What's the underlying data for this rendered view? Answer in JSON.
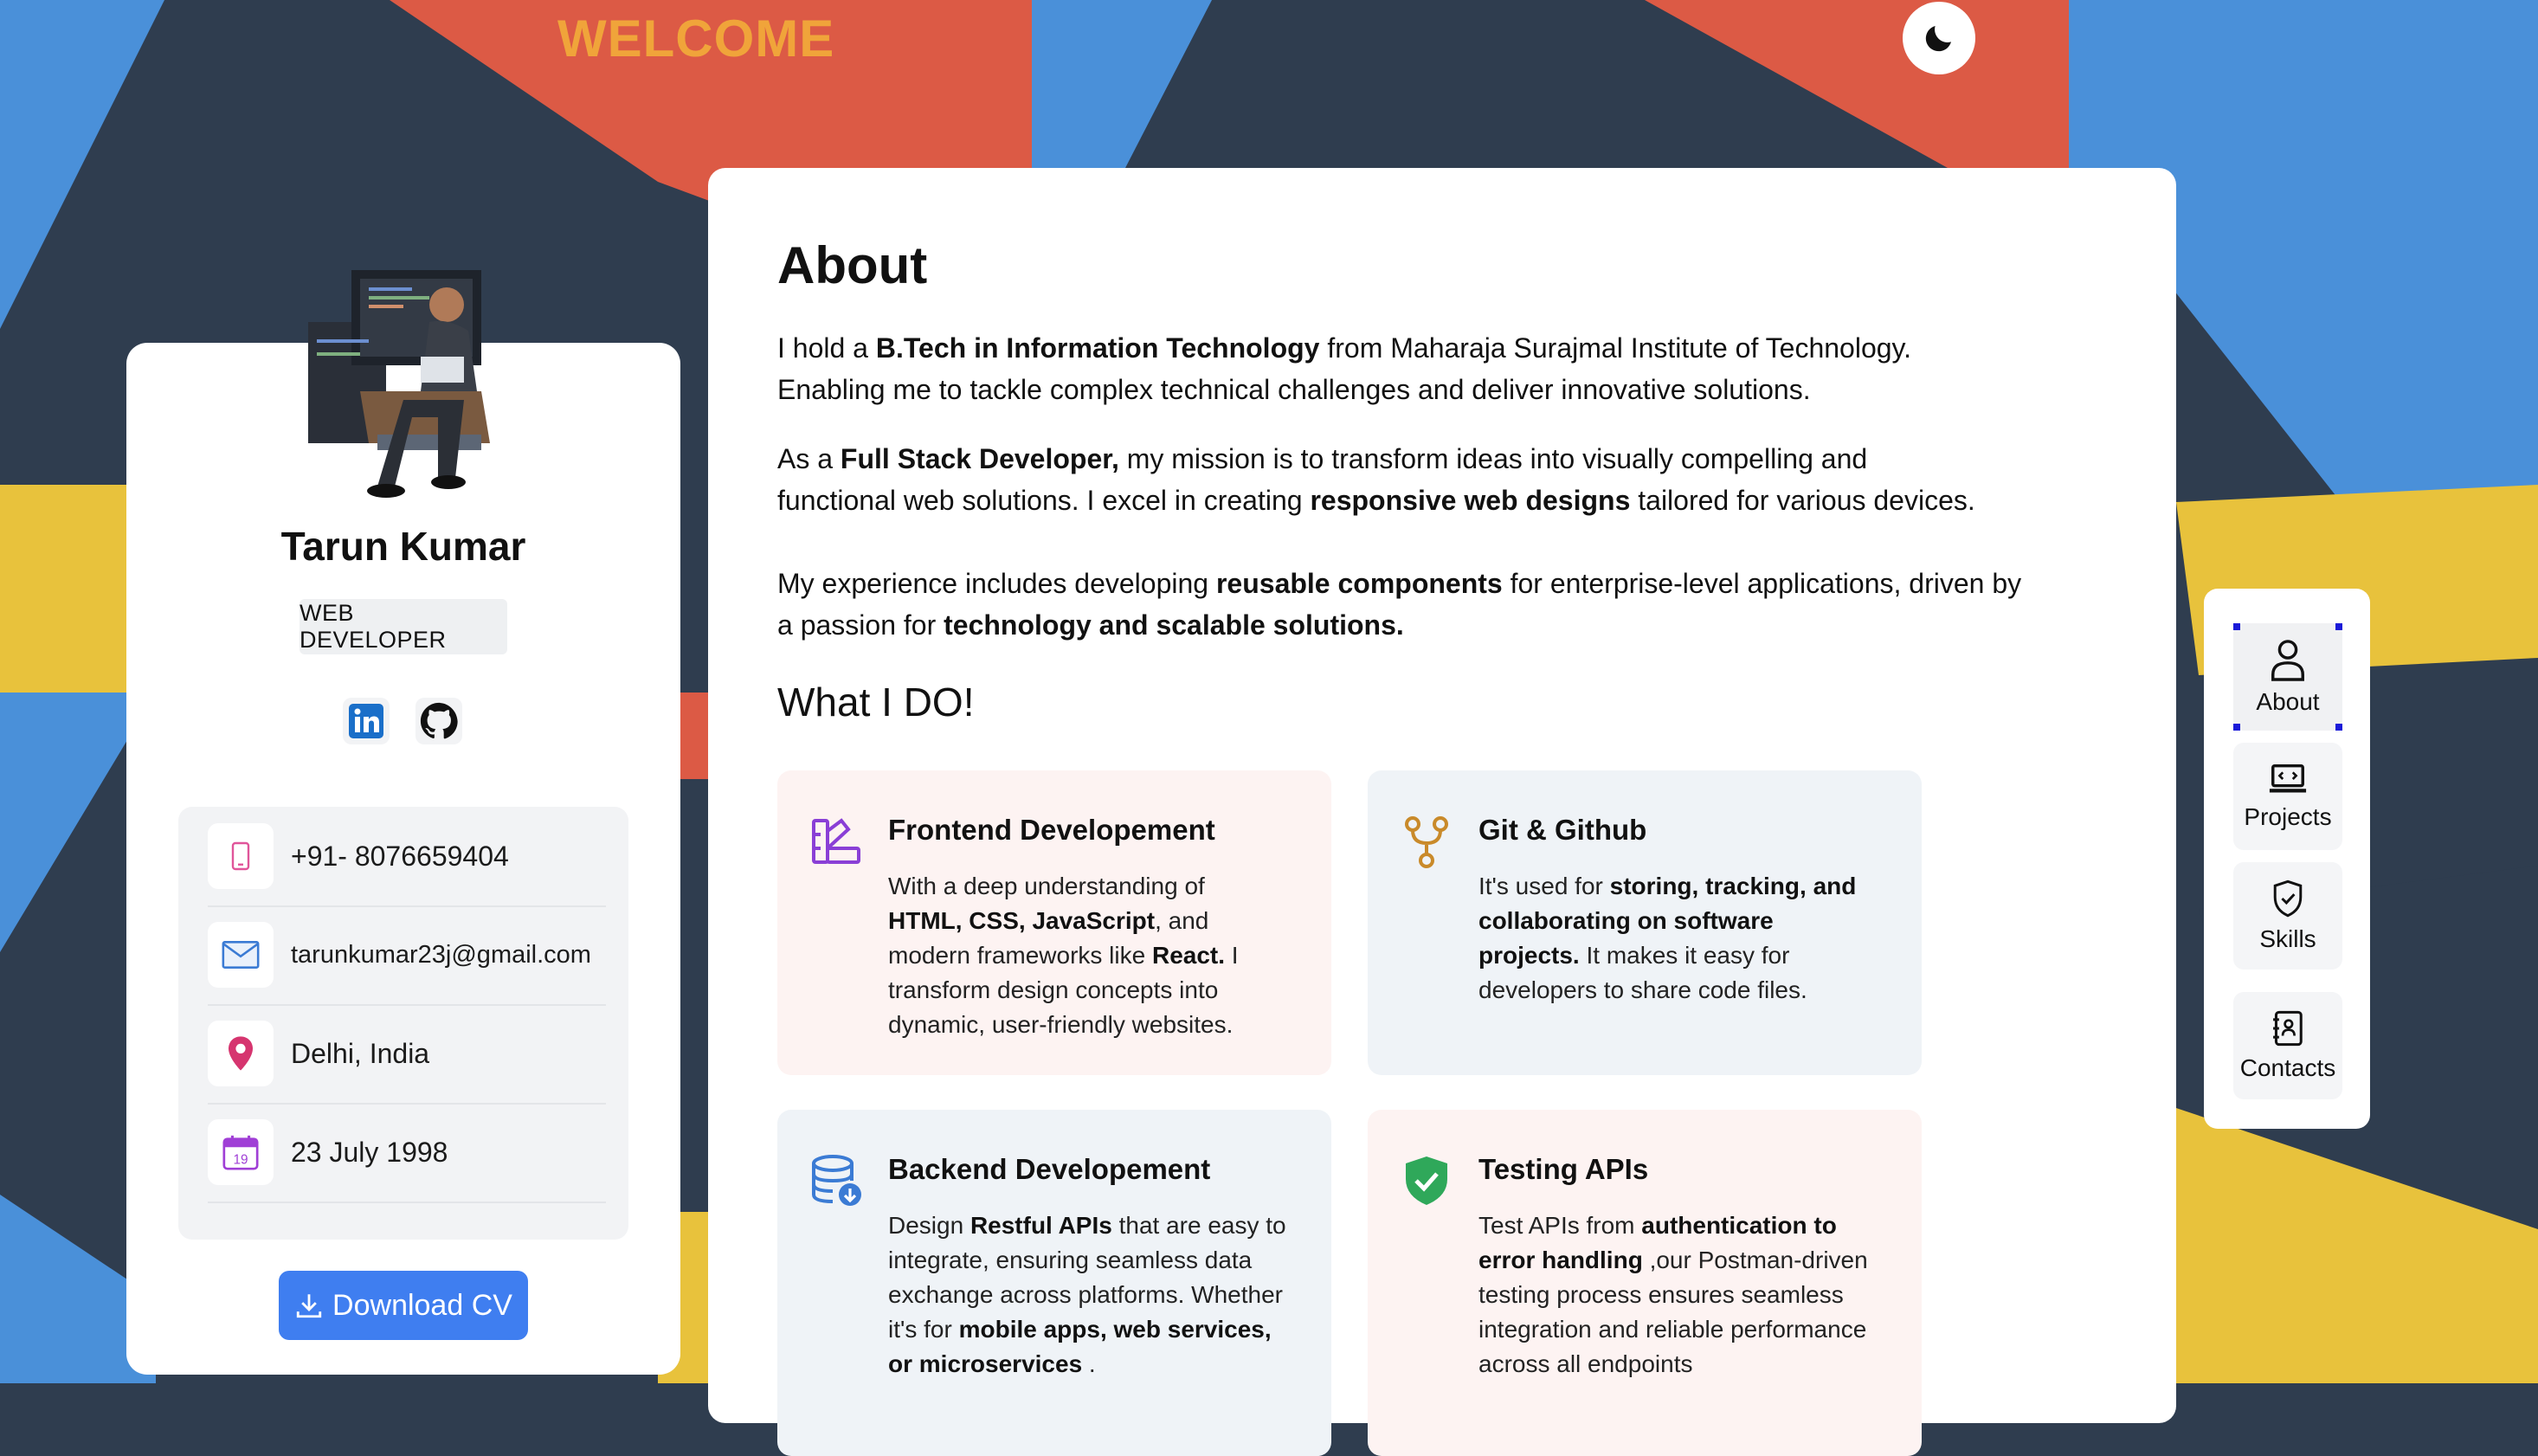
{
  "header": {
    "welcome": "WELCOME",
    "theme_toggle_icon": "moon-icon"
  },
  "profile": {
    "name": "Tarun Kumar",
    "role": "WEB DEVELOPER",
    "avatar_icon": "developer-illustration",
    "socials": [
      {
        "icon": "linkedin-icon"
      },
      {
        "icon": "github-icon"
      }
    ],
    "contacts": {
      "phone": "+91- 8076659404",
      "email": "tarunkumar23j@gmail.com",
      "location": "Delhi, India",
      "birthday": "23 July 1998",
      "calendar_day": "19"
    },
    "download_label": "Download CV"
  },
  "about": {
    "title": "About",
    "p1": {
      "t1": "I hold a ",
      "b1": "B.Tech in Information Technology",
      "t2": " from Maharaja Surajmal Institute of Technology.",
      "t3": "Enabling me to tackle complex technical challenges and deliver innovative solutions."
    },
    "p2": {
      "t1": "As a ",
      "b1": "Full Stack Developer,",
      "t2": " my mission is to transform ideas into visually compelling and",
      "t3": "functional web solutions. I excel in creating ",
      "b2": "responsive web designs",
      "t4": " tailored for various devices."
    },
    "p3": {
      "t1": "My experience includes developing ",
      "b1": "reusable components",
      "t2": " for enterprise-level applications, driven by",
      "t3": "a passion for ",
      "b2": "technology and scalable solutions."
    },
    "what_title": "What I DO!"
  },
  "services": {
    "frontend": {
      "title": "Frontend Developement",
      "d1": "With a deep understanding of",
      "b1": "HTML, CSS, JavaScript",
      "d2": ", and",
      "d3": "modern frameworks like ",
      "b2": "React.",
      "d4": " I",
      "d5": "transform design concepts into",
      "d6": "dynamic, user-friendly websites."
    },
    "git": {
      "title": "Git & Github",
      "d1": "It's used for ",
      "b1": "storing, tracking, and",
      "b2": "collaborating on software",
      "b3": "projects.",
      "d2": " It makes it easy for",
      "d3": "developers to share code files."
    },
    "backend": {
      "title": "Backend Developement",
      "d1": "Design ",
      "b1": "Restful APIs",
      "d2": " that are easy to",
      "d3": "integrate, ensuring seamless data",
      "d4": "exchange across platforms. Whether",
      "d5": "it's for ",
      "b2": "mobile apps, web services,",
      "b3": "or microservices",
      "d6": " ."
    },
    "testing": {
      "title": "Testing APIs",
      "d1": "Test APIs from ",
      "b1": "authentication to",
      "b2": "error handling",
      "d2": " ,our Postman-driven",
      "d3": "testing process ensures seamless",
      "d4": "integration and reliable performance",
      "d5": "across all endpoints"
    }
  },
  "nav": {
    "items": [
      {
        "label": "About",
        "icon": "user-icon",
        "active": true
      },
      {
        "label": "Projects",
        "icon": "laptop-code-icon",
        "active": false
      },
      {
        "label": "Skills",
        "icon": "shield-check-icon",
        "active": false
      },
      {
        "label": "Contacts",
        "icon": "address-book-icon",
        "active": false
      }
    ]
  },
  "colors": {
    "bg_dark": "#2f3d4f",
    "bg_blue": "#4a90d9",
    "bg_red": "#dc5a45",
    "bg_yellow": "#e8c23c",
    "accent": "#f0a43a",
    "button": "#3f7ef0"
  }
}
